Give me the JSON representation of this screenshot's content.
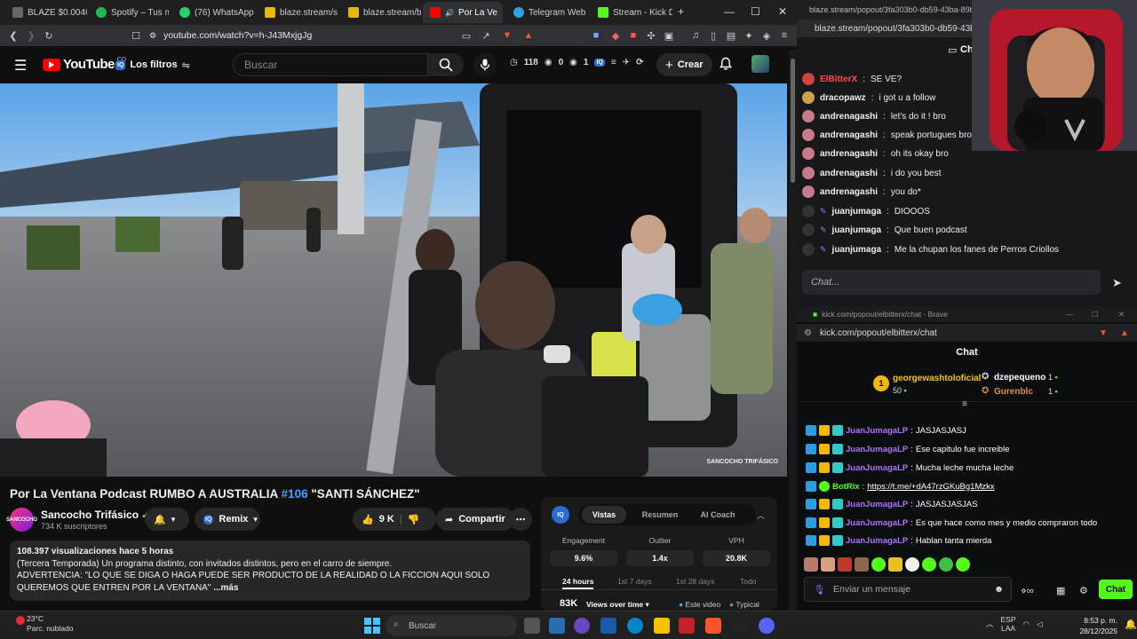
{
  "left_browser": {
    "tabs": [
      {
        "label": "BLAZE $0.0046(",
        "color": "#888888"
      },
      {
        "label": "Spotify – Tus me",
        "color": "#1db954"
      },
      {
        "label": "(76) WhatsApp",
        "color": "#25d366"
      },
      {
        "label": "blaze.stream/stre",
        "color": "#e6b800"
      },
      {
        "label": "blaze.stream/bac",
        "color": "#e6b800"
      },
      {
        "label": "Por La Ve",
        "color": "#ff0000"
      },
      {
        "label": "Telegram Web",
        "color": "#2aa3e0"
      },
      {
        "label": "Stream - Kick Da",
        "color": "#53fc18"
      }
    ],
    "url": "youtube.com/watch?v=h-J43MxjgJg"
  },
  "youtube": {
    "brand": "YouTube",
    "country_code": "CO",
    "filters_label": "Los filtros",
    "search_placeholder": "Buscar",
    "ext_stats": [
      "118",
      "0",
      "1"
    ],
    "create_label": "Crear",
    "video_title_main": "Por La Ventana Podcast RUMBO A AUSTRALIA ",
    "video_title_tag": "#106",
    "video_title_end": " \"SANTI SÁNCHEZ\"",
    "watermark": "SANCOCHO TRIFÁSICO",
    "channel": {
      "avatar_text": "SANCOCHO",
      "name": "Sancocho Trifásico",
      "subs": "734 K suscriptores"
    },
    "remix_label": "Remix",
    "likes": "9 K",
    "share_label": "Compartir",
    "description": {
      "stats": "108.397 visualizaciones  hace 5 horas",
      "line1": "(Tercera Temporada) Un programa distinto, con invitados distintos, pero en el carro de siempre.",
      "line2": "ADVERTENCIA: \"LO QUE SE DIGA O HAGA PUEDE SER PRODUCTO DE LA REALIDAD O LA FICCION AQUI SOLO QUEREMOS QUE ENTREN POR LA VENTANA\"",
      "more": "...más"
    },
    "analytics": {
      "logo": "IQ",
      "tabs": [
        "Vistas",
        "Resumen",
        "AI Coach"
      ],
      "metrics": [
        {
          "label": "Engagement",
          "value": "9.6%"
        },
        {
          "label": "Outlier",
          "value": "1.4x"
        },
        {
          "label": "VPH",
          "value": "20.8K"
        }
      ],
      "time_tabs": [
        "24 hours",
        "1st 7 days",
        "1st 28 days",
        "Todo"
      ],
      "views_value": "83K",
      "views_label": "Views over time",
      "legend_this": "Este video",
      "legend_typical": "Typical"
    }
  },
  "twitch_popout": {
    "tab_title": "blaze.stream/popout/3fa303b0-db59-43ba-89b5-96",
    "url": "blaze.stream/popout/3fa303b0-db59-43ba",
    "header": "Chat",
    "messages": [
      {
        "name": "ElBitterX",
        "text": "SE VE?",
        "name_color": "#ff4a4a",
        "av": "#c44"
      },
      {
        "name": "dracopawz",
        "text": "i got u a follow",
        "name_color": "#efeff1",
        "av": "#c9a44a"
      },
      {
        "name": "andrenagashi",
        "text": "let's do it ! bro",
        "name_color": "#efeff1",
        "av": "#c87a8a"
      },
      {
        "name": "andrenagashi",
        "text": "speak portugues bro?",
        "name_color": "#efeff1",
        "av": "#c87a8a"
      },
      {
        "name": "andrenagashi",
        "text": "oh its okay bro",
        "name_color": "#efeff1",
        "av": "#c87a8a"
      },
      {
        "name": "andrenagashi",
        "text": "i do you best",
        "name_color": "#efeff1",
        "av": "#c87a8a"
      },
      {
        "name": "andrenagashi",
        "text": "you do*",
        "name_color": "#efeff1",
        "av": "#c87a8a"
      },
      {
        "name": "juanjumaga",
        "text": "DIOOOS",
        "name_color": "#efeff1",
        "av": "#333"
      },
      {
        "name": "juanjumaga",
        "text": "Que buen podcast",
        "name_color": "#efeff1",
        "av": "#333"
      },
      {
        "name": "juanjumaga",
        "text": "Me la chupan los fanes de Perros Criollos",
        "name_color": "#efeff1",
        "av": "#333"
      }
    ],
    "input_placeholder": "Chat..."
  },
  "kick_popout": {
    "tab_title": "kick.com/popout/elbitterx/chat - Brave",
    "url": "kick.com/popout/elbitterx/chat",
    "header": "Chat",
    "leaderboard": [
      {
        "name": "georgewashtoloficial",
        "count": "50",
        "rank": "1"
      },
      {
        "name": "dzepequeno",
        "count": "1"
      },
      {
        "name": "Gurenblc",
        "count": "1"
      }
    ],
    "messages": [
      {
        "name": "JuanJumagaLP",
        "text": "JASJASJASJ"
      },
      {
        "name": "JuanJumagaLP",
        "text": "Ese capitulo fue increible"
      },
      {
        "name": "JuanJumagaLP",
        "text": "Mucha leche mucha leche"
      },
      {
        "name": "BotRix",
        "text": "https://t.me/+dA47rzGKuBg1Mzkx",
        "is_bot": true
      },
      {
        "name": "JuanJumagaLP",
        "text": "JASJASJASJAS"
      },
      {
        "name": "JuanJumagaLP",
        "text": "Es que hace como mes y medio compraron todo"
      },
      {
        "name": "JuanJumagaLP",
        "text": "Hablan tanta mierda"
      }
    ],
    "input_placeholder": "Enviar un mensaje",
    "send_label": "Chat"
  },
  "taskbar": {
    "temperature": "23°C",
    "weather": "Parc. nublado",
    "search_placeholder": "Buscar",
    "lang1": "ESP",
    "lang2": "LAA",
    "time": "8:53 p. m.",
    "date": "28/12/2025"
  }
}
